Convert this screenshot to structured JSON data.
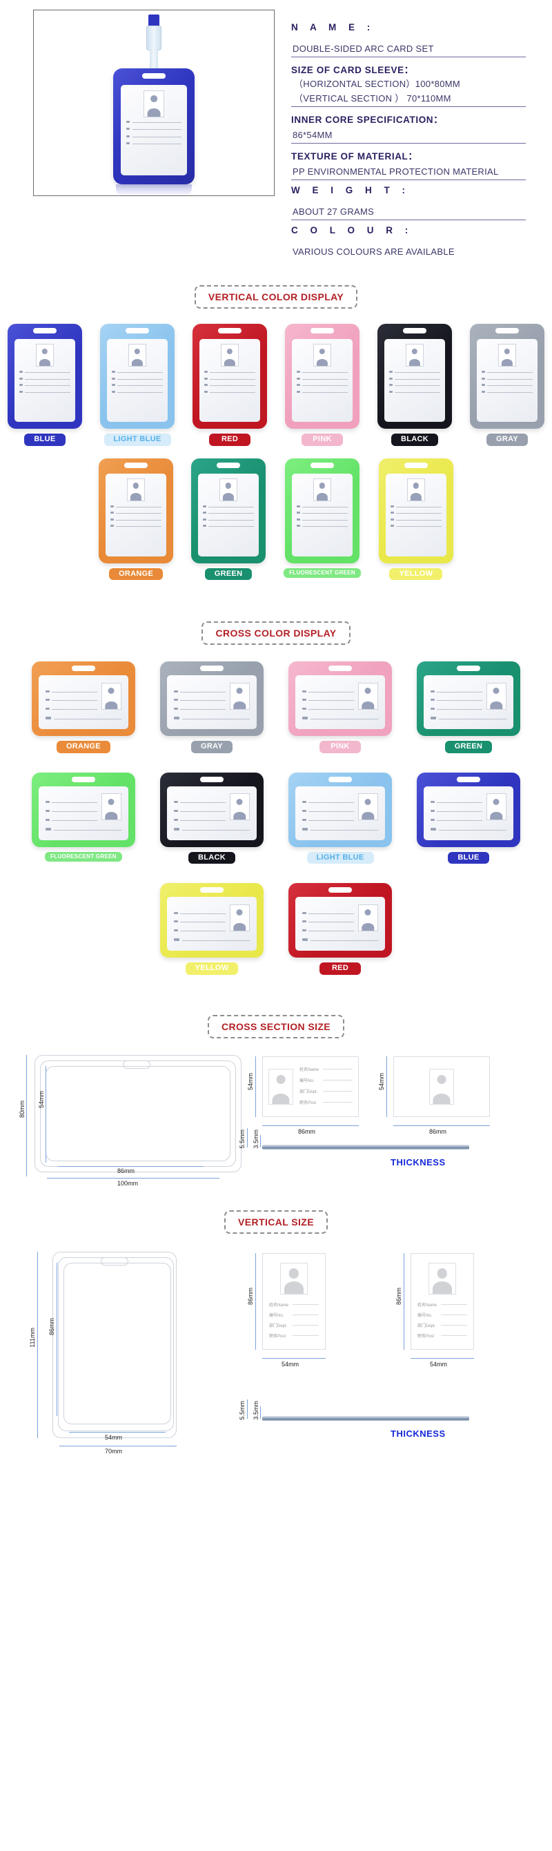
{
  "spec": {
    "name_label": "N A M E :",
    "name_value": "DOUBLE-SIDED ARC CARD SET",
    "size_label": "SIZE OF CARD SLEEVE：",
    "size_horizontal": "（HORIZONTAL SECTION）100*80MM",
    "size_vertical": "（VERTICAL SECTION  ）    70*110MM",
    "inner_core_label": "INNER CORE SPECIFICATION：",
    "inner_core_value": "86*54MM",
    "texture_label": "TEXTURE OF MATERIAL：",
    "texture_value": "PP ENVIRONMENTAL PROTECTION MATERIAL",
    "weight_label": "W E I G H T :",
    "weight_value": "ABOUT 27 GRAMS",
    "colour_label": "C O L O U R :",
    "colour_value": "VARIOUS COLOURS ARE AVAILABLE"
  },
  "banners": {
    "vertical_color": "VERTICAL COLOR DISPLAY",
    "cross_color": "CROSS COLOR DISPLAY",
    "cross_section_size": "CROSS SECTION SIZE",
    "vertical_size": "VERTICAL SIZE"
  },
  "vertical_colors": [
    {
      "label": "BLUE",
      "body": "#2f35bf",
      "body2": "#4b52d6",
      "pill_bg": "#2f35bf",
      "pill_fg": "#ffffff"
    },
    {
      "label": "LIGHT BLUE",
      "body": "#89c3ee",
      "body2": "#a5d3f4",
      "pill_bg": "#d6ecfa",
      "pill_fg": "#57b0e8"
    },
    {
      "label": "RED",
      "body": "#c01622",
      "body2": "#d5303c",
      "pill_bg": "#c01622",
      "pill_fg": "#ffffff"
    },
    {
      "label": "PINK",
      "body": "#f0a0bd",
      "body2": "#f6b6ce",
      "pill_bg": "#f3b7cd",
      "pill_fg": "#ffffff"
    },
    {
      "label": "BLACK",
      "body": "#15161d",
      "body2": "#2b2d38",
      "pill_bg": "#15161d",
      "pill_fg": "#ffffff"
    },
    {
      "label": "GRAY",
      "body": "#98a0ad",
      "body2": "#aab2bd",
      "pill_bg": "#98a0ad",
      "pill_fg": "#ffffff"
    },
    {
      "label": "ORANGE",
      "body": "#e88a37",
      "body2": "#f09f52",
      "pill_bg": "#e88a37",
      "pill_fg": "#ffffff"
    },
    {
      "label": "GREEN",
      "body": "#19906f",
      "body2": "#2ba588",
      "pill_bg": "#19906f",
      "pill_fg": "#ffffff"
    },
    {
      "label": "FLUORESCENT GREEN",
      "body": "#63e267",
      "body2": "#7dee80",
      "pill_bg": "#7fe883",
      "pill_fg": "#ffffff"
    },
    {
      "label": "YELLOW",
      "body": "#e9e84a",
      "body2": "#f0ef6b",
      "pill_bg": "#f2f06a",
      "pill_fg": "#ffffff"
    }
  ],
  "cross_colors": [
    {
      "label": "ORANGE",
      "body": "#ea8b3a",
      "body2": "#f2a055",
      "pill_bg": "#ea8b3a",
      "pill_fg": "#ffffff"
    },
    {
      "label": "GRAY",
      "body": "#97a0ac",
      "body2": "#aab2bd",
      "pill_bg": "#97a0ac",
      "pill_fg": "#ffffff"
    },
    {
      "label": "PINK",
      "body": "#f0a2be",
      "body2": "#f6b8cf",
      "pill_bg": "#f3b7cd",
      "pill_fg": "#ffffff"
    },
    {
      "label": "GREEN",
      "body": "#19906f",
      "body2": "#2ba588",
      "pill_bg": "#19906f",
      "pill_fg": "#ffffff"
    },
    {
      "label": "FLUORESCENT GREEN",
      "body": "#63e267",
      "body2": "#7dee80",
      "pill_bg": "#7fe883",
      "pill_fg": "#ffffff"
    },
    {
      "label": "BLACK",
      "body": "#15161d",
      "body2": "#2b2d38",
      "pill_bg": "#15161d",
      "pill_fg": "#ffffff"
    },
    {
      "label": "LIGHT BLUE",
      "body": "#89c3ee",
      "body2": "#a5d3f4",
      "pill_bg": "#d6ecfa",
      "pill_fg": "#57b0e8"
    },
    {
      "label": "BLUE",
      "body": "#2f35bf",
      "body2": "#4b52d6",
      "pill_bg": "#2f35bf",
      "pill_fg": "#ffffff"
    },
    {
      "label": "YELLOW",
      "body": "#e9e84a",
      "body2": "#f0ef6b",
      "pill_bg": "#f2f06a",
      "pill_fg": "#ffffff"
    },
    {
      "label": "RED",
      "body": "#c01622",
      "body2": "#d5303c",
      "pill_bg": "#c01622",
      "pill_fg": "#ffffff"
    }
  ],
  "card_fields": [
    {
      "cn": "姓名",
      "en": "Name"
    },
    {
      "cn": "编号",
      "en": "No."
    },
    {
      "cn": "部门",
      "en": "Dept."
    },
    {
      "cn": "职务",
      "en": "Post"
    }
  ],
  "cross_section": {
    "sleeve_height": "80mm",
    "card_height": "54mm",
    "card_width": "86mm",
    "sleeve_width": "100mm",
    "detail_height_1": "54mm",
    "detail_width_1": "86mm",
    "detail_height_2": "54mm",
    "detail_width_2": "86mm",
    "thickness_outer": "5.5mm",
    "thickness_inner": "3.5mm",
    "thickness_label": "THICKNESS"
  },
  "vertical_section": {
    "sleeve_height": "111mm",
    "card_height": "86mm",
    "card_width": "54mm",
    "sleeve_width": "70mm",
    "detail_height_1": "86mm",
    "detail_width_1": "54mm",
    "detail_height_2": "86mm",
    "detail_width_2": "54mm",
    "thickness_outer": "5.5mm",
    "thickness_inner": "3.5mm",
    "thickness_label": "THICKNESS"
  },
  "colors": {
    "accent_red": "#b31f24",
    "spec_text": "#2a2060",
    "dimension_blue": "#7ba2dd",
    "thickness_blue": "#1528d8"
  }
}
